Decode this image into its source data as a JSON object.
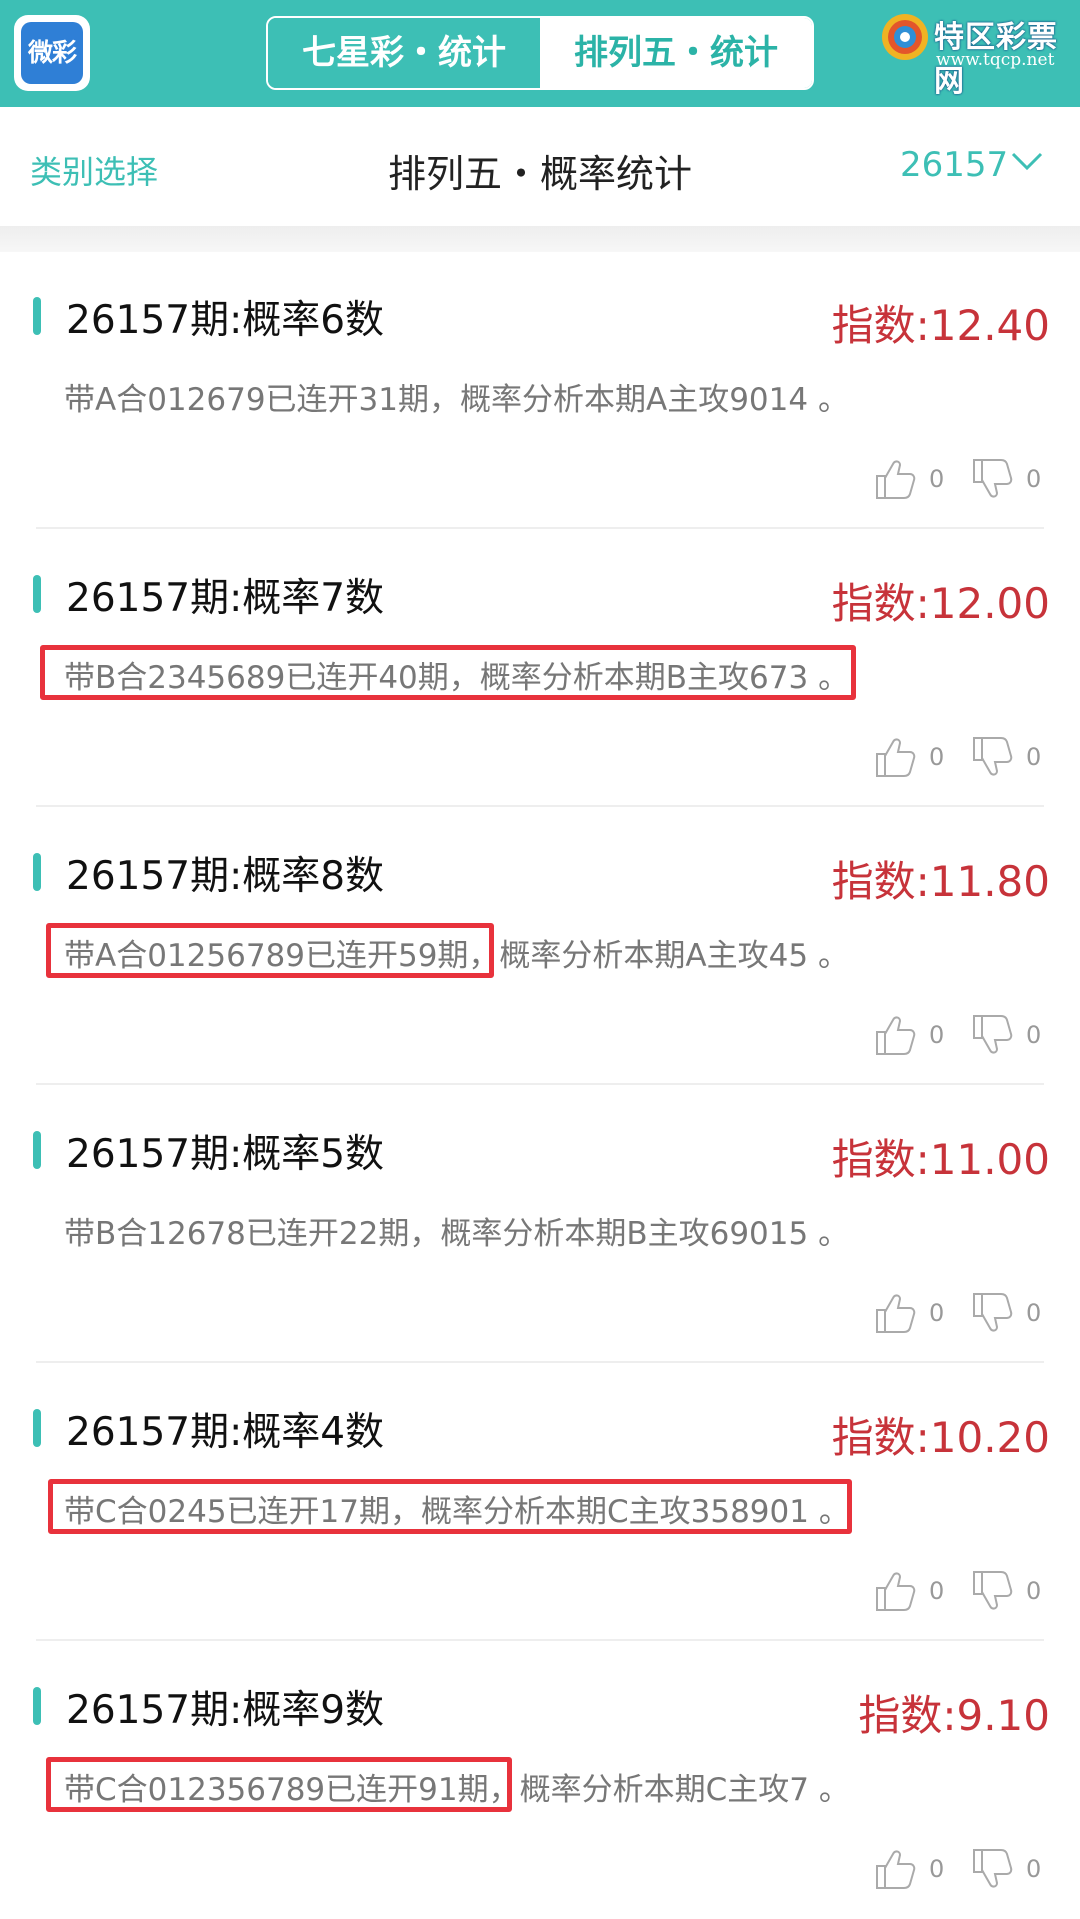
{
  "header": {
    "app_logo_text": "微彩",
    "tabs": [
      {
        "label": "七星彩・统计",
        "active": false
      },
      {
        "label": "排列五・统计",
        "active": true
      }
    ],
    "brand_name": "特区彩票网",
    "brand_url": "www.tqcp.net"
  },
  "subheader": {
    "category_label": "类别选择",
    "title": "排列五・概率统计",
    "issue": "26157"
  },
  "colors": {
    "accent": "#3dbfb5",
    "score": "#c7333a",
    "highlight_box": "#e8323c"
  },
  "cards": [
    {
      "title": "26157期:概率6数",
      "score": "指数:12.40",
      "desc": "带A合012679已连开31期，概率分析本期A主攻9014 。",
      "likes": "0",
      "dislikes": "0"
    },
    {
      "title": "26157期:概率7数",
      "score": "指数:12.00",
      "desc": "带B合2345689已连开40期，概率分析本期B主攻673 。",
      "likes": "0",
      "dislikes": "0"
    },
    {
      "title": "26157期:概率8数",
      "score": "指数:11.80",
      "desc": "带A合01256789已连开59期，概率分析本期A主攻45 。",
      "likes": "0",
      "dislikes": "0"
    },
    {
      "title": "26157期:概率5数",
      "score": "指数:11.00",
      "desc": "带B合12678已连开22期，概率分析本期B主攻69015 。",
      "likes": "0",
      "dislikes": "0"
    },
    {
      "title": "26157期:概率4数",
      "score": "指数:10.20",
      "desc": "带C合0245已连开17期，概率分析本期C主攻358901 。",
      "likes": "0",
      "dislikes": "0"
    },
    {
      "title": "26157期:概率9数",
      "score": "指数:9.10",
      "desc": "带C合012356789已连开91期，概率分析本期C主攻7 。",
      "likes": "0",
      "dislikes": "0"
    }
  ]
}
